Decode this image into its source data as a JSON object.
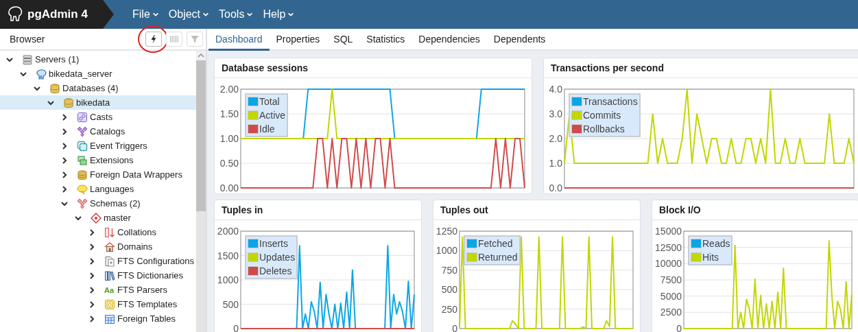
{
  "app": {
    "title": "pgAdmin 4"
  },
  "menu": [
    {
      "label": "File"
    },
    {
      "label": "Object"
    },
    {
      "label": "Tools"
    },
    {
      "label": "Help"
    }
  ],
  "browser": {
    "title": "Browser",
    "toolbar": [
      {
        "kind": "query",
        "disabled": false,
        "highlighted": true
      },
      {
        "kind": "grid",
        "disabled": true,
        "highlighted": false
      },
      {
        "kind": "filter",
        "disabled": true,
        "highlighted": false
      }
    ],
    "tree": [
      {
        "label": "Servers (1)",
        "kind": "servers",
        "expanded": true,
        "selected": false,
        "children": [
          {
            "label": "bikedata_server",
            "kind": "server",
            "expanded": true,
            "selected": false,
            "children": [
              {
                "label": "Databases (4)",
                "kind": "databases",
                "expanded": true,
                "selected": false,
                "children": [
                  {
                    "label": "bikedata",
                    "kind": "database",
                    "expanded": true,
                    "selected": true,
                    "children": [
                      {
                        "label": "Casts",
                        "kind": "casts",
                        "expanded": false,
                        "selected": false
                      },
                      {
                        "label": "Catalogs",
                        "kind": "catalogs",
                        "expanded": false,
                        "selected": false
                      },
                      {
                        "label": "Event Triggers",
                        "kind": "triggers",
                        "expanded": false,
                        "selected": false
                      },
                      {
                        "label": "Extensions",
                        "kind": "extensions",
                        "expanded": false,
                        "selected": false
                      },
                      {
                        "label": "Foreign Data Wrappers",
                        "kind": "wrappers",
                        "expanded": false,
                        "selected": false
                      },
                      {
                        "label": "Languages",
                        "kind": "languages",
                        "expanded": false,
                        "selected": false
                      },
                      {
                        "label": "Schemas (2)",
                        "kind": "schemas",
                        "expanded": true,
                        "selected": false,
                        "children": [
                          {
                            "label": "master",
                            "kind": "schema",
                            "expanded": true,
                            "selected": false,
                            "children": [
                              {
                                "label": "Collations",
                                "kind": "collations",
                                "expanded": false,
                                "selected": false
                              },
                              {
                                "label": "Domains",
                                "kind": "domains",
                                "expanded": false,
                                "selected": false
                              },
                              {
                                "label": "FTS Configurations",
                                "kind": "document",
                                "expanded": false,
                                "selected": false
                              },
                              {
                                "label": "FTS Dictionaries",
                                "kind": "books",
                                "expanded": false,
                                "selected": false
                              },
                              {
                                "label": "FTS Parsers",
                                "kind": "glyph",
                                "icon_text": "Aa",
                                "expanded": false,
                                "selected": false
                              },
                              {
                                "label": "FTS Templates",
                                "kind": "templates",
                                "expanded": false,
                                "selected": false
                              },
                              {
                                "label": "Foreign Tables",
                                "kind": "table",
                                "expanded": false,
                                "selected": false
                              }
                            ]
                          }
                        ]
                      }
                    ]
                  }
                ]
              }
            ]
          }
        ]
      }
    ]
  },
  "tabs": [
    {
      "label": "Dashboard",
      "selected": true
    },
    {
      "label": "Properties",
      "selected": false
    },
    {
      "label": "SQL",
      "selected": false
    },
    {
      "label": "Statistics",
      "selected": false
    },
    {
      "label": "Dependencies",
      "selected": false
    },
    {
      "label": "Dependents",
      "selected": false
    }
  ],
  "charts": [
    {
      "chart_data": {
        "type": "line",
        "title": "Database sessions",
        "grid": true,
        "legend": true,
        "ylim": [
          0,
          2
        ],
        "yticks": [
          {
            "value": 0,
            "label": "0.00"
          },
          {
            "value": 0.5,
            "label": "0.50"
          },
          {
            "value": 1,
            "label": "1.00"
          },
          {
            "value": 1.5,
            "label": "1.50"
          },
          {
            "value": 2,
            "label": "2.00"
          }
        ],
        "series": [
          {
            "name": "Total",
            "color": "#0ba5e6",
            "values": [
              null,
              null,
              null,
              null,
              null,
              null,
              null,
              null,
              null,
              null,
              null,
              null,
              null,
              1,
              2,
              2,
              2,
              2,
              2,
              2,
              2,
              2,
              2,
              2,
              2,
              2,
              2,
              2,
              2,
              2,
              2,
              2,
              1,
              null,
              null,
              null,
              null,
              null,
              null,
              null,
              null,
              null,
              null,
              null,
              null,
              null,
              null,
              null,
              null,
              1,
              2,
              2,
              2,
              2,
              2,
              2,
              2,
              2,
              2,
              2
            ]
          },
          {
            "name": "Active",
            "color": "#c2d600",
            "values": [
              1,
              1,
              1,
              1,
              1,
              1,
              1,
              1,
              1,
              1,
              1,
              1,
              1,
              1,
              1,
              1,
              1,
              1,
              1,
              2,
              1,
              1,
              1,
              1,
              1,
              1,
              1,
              1,
              1,
              1,
              1,
              1,
              1,
              1,
              1,
              1,
              1,
              1,
              1,
              1,
              1,
              1,
              1,
              1,
              1,
              1,
              1,
              1,
              1,
              1,
              1,
              1,
              1,
              1,
              1,
              1,
              1,
              1,
              1,
              1
            ]
          },
          {
            "name": "Idle",
            "color": "#d04a4a",
            "values": [
              0,
              0,
              0,
              0,
              0,
              0,
              0,
              0,
              0,
              0,
              0,
              0,
              0,
              0,
              0,
              0,
              1,
              1,
              0,
              1,
              0,
              1,
              1,
              0,
              1,
              0,
              1,
              0,
              1,
              1,
              0,
              1,
              0,
              0,
              0,
              0,
              0,
              0,
              0,
              0,
              0,
              0,
              0,
              0,
              0,
              0,
              0,
              0,
              0,
              0,
              0,
              0,
              0,
              1,
              0,
              1,
              0,
              1,
              1,
              0
            ]
          }
        ]
      }
    },
    {
      "chart_data": {
        "type": "line",
        "title": "Transactions per second",
        "grid": true,
        "legend": true,
        "ylim": [
          0,
          4
        ],
        "yticks": [
          {
            "value": 0,
            "label": "0.0"
          },
          {
            "value": 1,
            "label": "1.0"
          },
          {
            "value": 2,
            "label": "2.0"
          },
          {
            "value": 3,
            "label": "3.0"
          },
          {
            "value": 4,
            "label": "4.0"
          }
        ],
        "series": [
          {
            "name": "Transactions",
            "color": "#0ba5e6"
          },
          {
            "name": "Commits",
            "color": "#c2d600",
            "values": [
              1,
              3,
              1,
              1,
              1,
              1,
              1,
              1,
              1,
              1,
              1,
              1,
              1,
              1,
              1,
              1,
              1,
              1,
              3,
              1,
              2,
              1,
              1,
              1,
              2,
              4,
              1,
              3,
              2,
              1,
              2,
              2,
              1,
              1,
              2,
              1,
              1,
              2,
              2,
              1,
              2,
              1,
              4,
              1,
              1,
              2,
              1,
              1,
              2,
              1,
              1,
              1,
              1,
              1,
              3,
              1,
              1,
              1,
              2,
              1
            ]
          },
          {
            "name": "Rollbacks",
            "color": "#d04a4a",
            "values": [
              0,
              0,
              0,
              0,
              0,
              0,
              0,
              0,
              0,
              0,
              0,
              0,
              0,
              0,
              0,
              0,
              0,
              0,
              0,
              0,
              0,
              0,
              0,
              0,
              0,
              0,
              0,
              0,
              0,
              0,
              0,
              0,
              0,
              0,
              0,
              0,
              0,
              0,
              0,
              0,
              0,
              0,
              0,
              0,
              0,
              0,
              0,
              0,
              0,
              0,
              0,
              0,
              0,
              0,
              0,
              0,
              0,
              0,
              0,
              0
            ]
          }
        ]
      }
    },
    {
      "chart_data": {
        "type": "line",
        "title": "Tuples in",
        "grid": true,
        "legend": true,
        "ylim": [
          0,
          2000
        ],
        "yticks": [
          0,
          500,
          1000,
          1500,
          2000
        ],
        "series": [
          {
            "name": "Inserts",
            "color": "#0ba5e6",
            "values": [
              null,
              null,
              null,
              null,
              null,
              null,
              null,
              null,
              null,
              null,
              null,
              null,
              null,
              null,
              null,
              null,
              null,
              null,
              null,
              0,
              1700,
              0,
              300,
              0,
              550,
              350,
              0,
              950,
              0,
              700,
              300,
              0,
              500,
              0,
              520,
              0,
              750,
              0,
              1200,
              0,
              null,
              null,
              null,
              null,
              null,
              null,
              null,
              null,
              null,
              0,
              1700,
              0,
              700,
              300,
              550,
              350,
              0,
              970,
              0,
              700
            ]
          },
          {
            "name": "Updates",
            "color": "#c2d600"
          },
          {
            "name": "Deletes",
            "color": "#d04a4a",
            "values": [
              0,
              0,
              0,
              0,
              0,
              0,
              0,
              0,
              0,
              0,
              0,
              0,
              0,
              0,
              0,
              0,
              0,
              0,
              0,
              0,
              0,
              0,
              0,
              0,
              0,
              0,
              0,
              0,
              0,
              0,
              0,
              0,
              0,
              0,
              0,
              0,
              0,
              0,
              0,
              0,
              0,
              0,
              0,
              0,
              0,
              0,
              0,
              0,
              0,
              0,
              0,
              0,
              0,
              0,
              0,
              0,
              0,
              0,
              0,
              0
            ]
          }
        ]
      }
    },
    {
      "chart_data": {
        "type": "line",
        "title": "Tuples out",
        "grid": true,
        "legend": true,
        "ylim": [
          0,
          1250
        ],
        "yticks": [
          0,
          250,
          500,
          750,
          1000,
          1250
        ],
        "series": [
          {
            "name": "Fetched",
            "color": "#0ba5e6"
          },
          {
            "name": "Returned",
            "color": "#c2d600",
            "values": [
              0,
              1175,
              0,
              0,
              0,
              0,
              0,
              0,
              0,
              0,
              0,
              0,
              0,
              0,
              0,
              0,
              0,
              0,
              100,
              60,
              0,
              1175,
              0,
              0,
              0,
              0,
              0,
              1175,
              0,
              0,
              0,
              0,
              0,
              0,
              0,
              1175,
              0,
              0,
              0,
              0,
              0,
              0,
              20,
              0,
              1175,
              0,
              0,
              0,
              0,
              0,
              100,
              30,
              1175,
              0,
              0,
              0,
              0,
              0,
              0,
              0
            ]
          }
        ]
      }
    },
    {
      "chart_data": {
        "type": "line",
        "title": "Block I/O",
        "grid": true,
        "legend": true,
        "ylim": [
          0,
          15000
        ],
        "yticks": [
          0,
          2500,
          5000,
          7500,
          10000,
          12500,
          15000
        ],
        "series": [
          {
            "name": "Reads",
            "color": "#0ba5e6"
          },
          {
            "name": "Hits",
            "color": "#c2d600",
            "values": [
              0,
              0,
              0,
              0,
              0,
              0,
              0,
              0,
              0,
              0,
              0,
              0,
              0,
              0,
              0,
              0,
              0,
              0,
              12800,
              0,
              2500,
              0,
              4500,
              3000,
              0,
              7600,
              0,
              5100,
              0,
              3800,
              0,
              4200,
              0,
              5600,
              0,
              9300,
              0,
              0,
              0,
              0,
              0,
              0,
              0,
              0,
              0,
              0,
              0,
              0,
              0,
              0,
              0,
              13500,
              5000,
              0,
              4200,
              3000,
              0,
              7200,
              0,
              5300
            ]
          }
        ]
      }
    }
  ]
}
